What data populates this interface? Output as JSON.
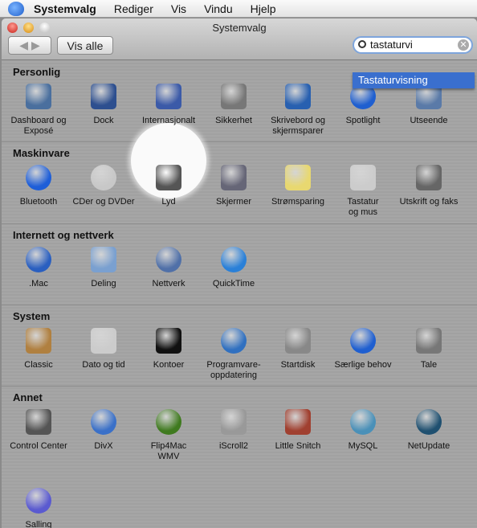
{
  "menubar": {
    "app": "Systemvalg",
    "items": [
      "Rediger",
      "Vis",
      "Vindu",
      "Hjelp"
    ]
  },
  "window": {
    "title": "Systemvalg",
    "show_all": "Vis alle"
  },
  "search": {
    "value": "tastaturvi",
    "suggestion": "Tastaturvisning"
  },
  "highlighted": "Internasjonalt",
  "sections": [
    {
      "title": "Personlig",
      "items": [
        {
          "label": "Dashboard og\nExposé",
          "icon": "dashboard-icon",
          "color": "#4a6f9e"
        },
        {
          "label": "Dock",
          "icon": "dock-icon",
          "color": "#2d4f8f"
        },
        {
          "label": "Internasjonalt",
          "icon": "flag-icon",
          "color": "#3b5aa8"
        },
        {
          "label": "Sikkerhet",
          "icon": "house-safe-icon",
          "color": "#777"
        },
        {
          "label": "Skrivebord og\nskjermsparer",
          "icon": "desktop-icon",
          "color": "#2860b0"
        },
        {
          "label": "Spotlight",
          "icon": "spotlight-icon",
          "color": "#1f5fd0"
        },
        {
          "label": "Utseende",
          "icon": "appearance-icon",
          "color": "#5a7aa8"
        }
      ]
    },
    {
      "title": "Maskinvare",
      "items": [
        {
          "label": "Bluetooth",
          "icon": "bluetooth-icon",
          "color": "#1e5ed8"
        },
        {
          "label": "CDer og DVDer",
          "icon": "cd-icon",
          "color": "#c8c8c8"
        },
        {
          "label": "Lyd",
          "icon": "speaker-icon",
          "color": "#555"
        },
        {
          "label": "Skjermer",
          "icon": "display-icon",
          "color": "#667"
        },
        {
          "label": "Strømsparing",
          "icon": "lightbulb-icon",
          "color": "#e8d870"
        },
        {
          "label": "Tastatur\nog mus",
          "icon": "keyboard-mouse-icon",
          "color": "#ccc"
        },
        {
          "label": "Utskrift og faks",
          "icon": "printer-icon",
          "color": "#666"
        }
      ]
    },
    {
      "title": "Internett og nettverk",
      "items": [
        {
          "label": ".Mac",
          "icon": "dotmac-icon",
          "color": "#2a5fc0"
        },
        {
          "label": "Deling",
          "icon": "sharing-folder-icon",
          "color": "#7aa0d0"
        },
        {
          "label": "Nettverk",
          "icon": "network-globe-icon",
          "color": "#5070a8"
        },
        {
          "label": "QuickTime",
          "icon": "quicktime-icon",
          "color": "#2a80d8"
        }
      ]
    },
    {
      "title": "System",
      "items": [
        {
          "label": "Classic",
          "icon": "classic-icon",
          "color": "#b08040"
        },
        {
          "label": "Dato og tid",
          "icon": "clock-calendar-icon",
          "color": "#ccc"
        },
        {
          "label": "Kontoer",
          "icon": "accounts-icon",
          "color": "#111"
        },
        {
          "label": "Programvare-\noppdatering",
          "icon": "software-update-icon",
          "color": "#3070c0"
        },
        {
          "label": "Startdisk",
          "icon": "disk-icon",
          "color": "#888"
        },
        {
          "label": "Særlige behov",
          "icon": "accessibility-icon",
          "color": "#1f5fd0"
        },
        {
          "label": "Tale",
          "icon": "microphone-icon",
          "color": "#777"
        }
      ]
    },
    {
      "title": "Annet",
      "items": [
        {
          "label": "Control Center",
          "icon": "logitech-icon",
          "color": "#555"
        },
        {
          "label": "DivX",
          "icon": "divx-icon",
          "color": "#3a70c8"
        },
        {
          "label": "Flip4Mac\nWMV",
          "icon": "wmv-icon",
          "color": "#3f7a1f"
        },
        {
          "label": "iScroll2",
          "icon": "iscroll-icon",
          "color": "#999"
        },
        {
          "label": "Little Snitch",
          "icon": "little-snitch-icon",
          "color": "#a04030"
        },
        {
          "label": "MySQL",
          "icon": "mysql-icon",
          "color": "#4a90b8"
        },
        {
          "label": "NetUpdate",
          "icon": "netupdate-icon",
          "color": "#1f5070"
        },
        {
          "label": "Salling\nClicker",
          "icon": "salling-clicker-icon",
          "color": "#5a5ad0"
        }
      ]
    }
  ]
}
